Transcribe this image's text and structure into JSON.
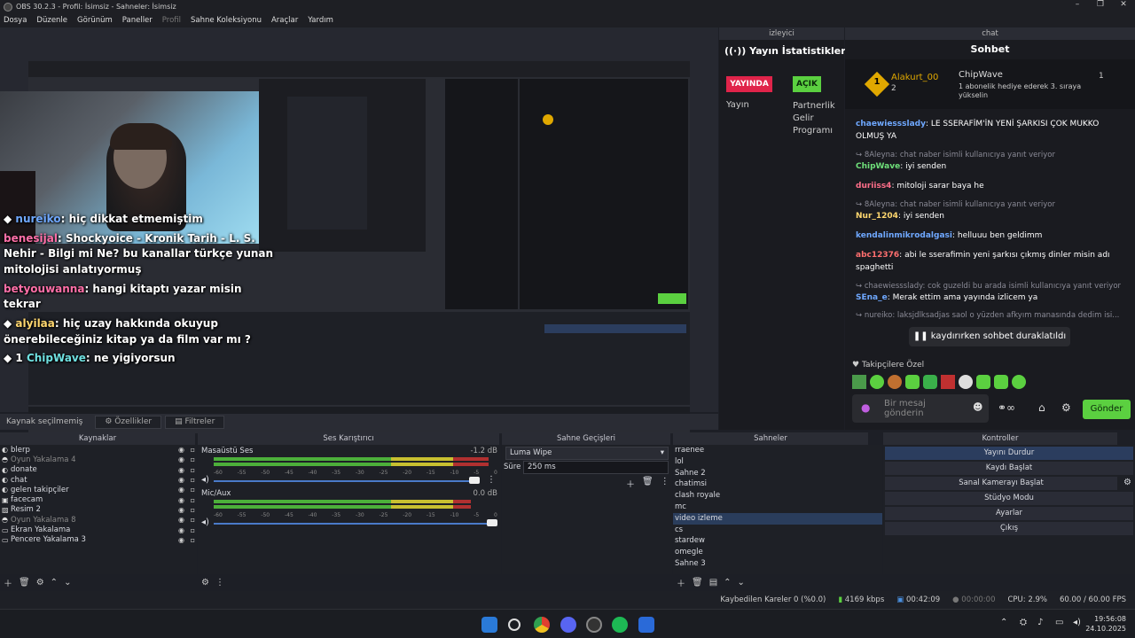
{
  "window": {
    "title": "OBS 30.2.3 - Profil: İsimsiz - Sahneler: İsimsiz",
    "min": "–",
    "max": "❐",
    "close": "✕"
  },
  "menu": [
    "Dosya",
    "Düzenle",
    "Görünüm",
    "Paneller",
    "Profil",
    "Sahne Koleksiyonu",
    "Araçlar",
    "Yardım"
  ],
  "overlay_chat": [
    {
      "badge": "◆",
      "user": "nureiko",
      "text": ": hiç dikkat etmemiştim"
    },
    {
      "badge": "",
      "user": "benesijal",
      "text": ": Shockyoice - Kronik Tarih - L. S."
    },
    {
      "badge": "",
      "user": "",
      "text": "Nehir - Bilgi mi Ne? bu kanallar türkçe yunan"
    },
    {
      "badge": "",
      "user": "",
      "text": "mitolojisi anlatıyormuş"
    },
    {
      "badge": "",
      "user": "betyouwanna",
      "text": ": hangi kitaptı yazar misin"
    },
    {
      "badge": "",
      "user": "",
      "text": "tekrar"
    },
    {
      "badge": "◆",
      "user": "alyilaa",
      "text": ": hiç uzay hakkında okuyup"
    },
    {
      "badge": "",
      "user": "",
      "text": "önerebileceğiniz kitap ya da film var mı ?"
    },
    {
      "badge": "◆ 1",
      "user": "ChipWave",
      "text": ": ne yigiyorsun"
    }
  ],
  "editbar": {
    "no_source": "Kaynak seçilmemiş",
    "props": "Özellikler",
    "filters": "Filtreler"
  },
  "sources": {
    "title": "Kaynaklar",
    "items": [
      {
        "name": "blerp",
        "dim": false
      },
      {
        "name": "Oyun Yakalama 4",
        "dim": true
      },
      {
        "name": "donate",
        "dim": false
      },
      {
        "name": "chat",
        "dim": false
      },
      {
        "name": "gelen takipçiler",
        "dim": false
      },
      {
        "name": "facecam",
        "dim": false
      },
      {
        "name": "Resim 2",
        "dim": false
      },
      {
        "name": "Oyun Yakalama 8",
        "dim": true
      },
      {
        "name": "Ekran Yakalama",
        "dim": false
      },
      {
        "name": "Pencere Yakalama 3",
        "dim": false
      }
    ]
  },
  "mixer": {
    "title": "Ses Karıştırıcı",
    "tracks": [
      {
        "name": "Masaüstü Ses",
        "db": "-1.2 dB",
        "level": 0.97
      },
      {
        "name": "Mic/Aux",
        "db": "0.0 dB",
        "level": 0.86
      }
    ],
    "scale": [
      "-60",
      "-55",
      "-50",
      "-45",
      "-40",
      "-35",
      "-30",
      "-25",
      "-20",
      "-15",
      "-10",
      "-5",
      "0"
    ]
  },
  "transitions": {
    "title": "Sahne Geçişleri",
    "selected": "Luma Wipe",
    "duration_label": "Süre",
    "duration": "250 ms"
  },
  "scenes": {
    "title": "Sahneler",
    "items": [
      "rraenee",
      "lol",
      "Sahne 2",
      "chatimsi",
      "clash royale",
      "mc",
      "video izleme",
      "cs",
      "stardew",
      "omegle",
      "Sahne 3"
    ],
    "selected_index": 6
  },
  "controls": {
    "title": "Kontroller",
    "buttons": [
      "Yayını Durdur",
      "Kaydı Başlat",
      "Sanal Kamerayı Başlat",
      "Stüdyo Modu",
      "Ayarlar",
      "Çıkış"
    ]
  },
  "stats": {
    "dock_title": "izleyici",
    "title": "Yayın İstatistikleri",
    "live": "YAYINDA",
    "open": "AÇIK",
    "label_left": "Yayın",
    "label_right": "Partnerlik Gelir Programı"
  },
  "chat": {
    "dock_title": "chat",
    "title": "Sohbet",
    "top_user": "Alakurt_00",
    "top_rank": "1",
    "top_count": "2",
    "gift_user": "ChipWave",
    "gift_text": "1 abonelik hediye ederek 3. sıraya yükselin",
    "gift_count": "1",
    "messages": [
      {
        "user": "chaewiessslady",
        "color": "#6fa8ff",
        "text": "LE SSERAFİM'İN YENİ ŞARKISI ÇOK MUKKO OLMUŞ YA"
      },
      {
        "system": "8Aleyna: chat naber isimli kullanıcıya yanıt veriyor"
      },
      {
        "user": "ChipWave",
        "color": "#6fe07a",
        "text": "iyi senden"
      },
      {
        "user": "duriiss4",
        "color": "#ff6f8a",
        "text": "mitoloji sarar baya he"
      },
      {
        "system": "8Aleyna: chat naber isimli kullanıcıya yanıt veriyor"
      },
      {
        "user": "Nur_1204",
        "color": "#ffd76f",
        "text": "iyi senden"
      },
      {
        "user": "kendalinmikrodalgasi",
        "color": "#6fa8ff",
        "text": "helluuu ben geldimm"
      },
      {
        "user": "abc12376",
        "color": "#ff6f6f",
        "text": "abi le sserafimin yeni şarkısı çıkmış dinler misin adı spaghetti"
      },
      {
        "system": "chaewiessslady: cok guzeldi bu arada isimli kullanıcıya yanıt veriyor"
      },
      {
        "user": "SEna_e",
        "color": "#6fa8ff",
        "text": "Merak ettim ama yayında izlicem ya"
      },
      {
        "system": "nureiko: laksjdlksadjas saol o yüzden afkyım manasında dedim isi..."
      }
    ],
    "paused": "kaydırırken sohbet duraklatıldı",
    "followers": "Takipçilere Özel",
    "input_placeholder": "Bir mesaj gönderin",
    "send": "Gönder"
  },
  "status": {
    "dropped": "Kaybedilen Kareler 0 (%0.0)",
    "bitrate": "4169 kbps",
    "stream_time": "00:42:09",
    "rec_time": "00:00:00",
    "cpu": "CPU: 2.9%",
    "fps": "60.00 / 60.00 FPS"
  },
  "clock": {
    "time": "19:56:08",
    "date": "24.10.2025"
  }
}
